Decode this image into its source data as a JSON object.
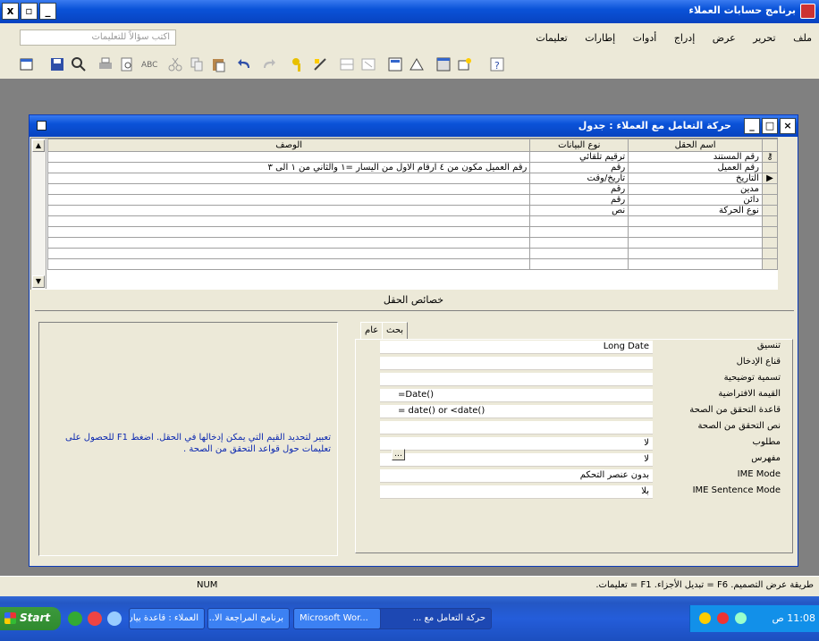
{
  "app": {
    "title": "برنامج حسابات العملاء",
    "min_label": "_",
    "max_label": "▫",
    "close_label": "x"
  },
  "menu": {
    "items": [
      "ملف",
      "تحرير",
      "عرض",
      "إدراج",
      "أدوات",
      "إطارات",
      "تعليمات"
    ],
    "ask_placeholder": "اكتب سؤالاً للتعليمات"
  },
  "child": {
    "title": "حركة التعامل مع العملاء : جدول"
  },
  "grid": {
    "headers": {
      "name": "اسم الحقل",
      "type": "نوع البيانات",
      "desc": "الوصف"
    },
    "rows": [
      {
        "name": "رقم المستند",
        "type": "ترقيم تلقائي",
        "desc": ""
      },
      {
        "name": "رقم العميل",
        "type": "رقم",
        "desc": "رقم العميل مكون من ٤ ارقام الاول من اليسار =١ والثاني من ١ الى ٣"
      },
      {
        "name": "التاريخ",
        "type": "تاريخ/وقت",
        "desc": ""
      },
      {
        "name": "مدين",
        "type": "رقم",
        "desc": ""
      },
      {
        "name": "دائن",
        "type": "رقم",
        "desc": ""
      },
      {
        "name": "نوع الحركة",
        "type": "نص",
        "desc": ""
      },
      {
        "name": "",
        "type": "",
        "desc": ""
      },
      {
        "name": "",
        "type": "",
        "desc": ""
      },
      {
        "name": "",
        "type": "",
        "desc": ""
      },
      {
        "name": "",
        "type": "",
        "desc": ""
      },
      {
        "name": "",
        "type": "",
        "desc": ""
      }
    ]
  },
  "properties": {
    "caption": "خصائص الحقل",
    "tabs": [
      "عام",
      "بحث"
    ],
    "rows": [
      {
        "label": "تنسيق",
        "value": "Long Date"
      },
      {
        "label": "قناع الإدخال",
        "value": ""
      },
      {
        "label": "تسمية توضيحية",
        "value": ""
      },
      {
        "label": "القيمة الافتراضية",
        "value": "=Date()"
      },
      {
        "label": "قاعدة التحقق من الصحة",
        "value": "= date() or <date()"
      },
      {
        "label": "نص التحقق من الصحة",
        "value": ""
      },
      {
        "label": "مطلوب",
        "value": "لا"
      },
      {
        "label": "مفهرس",
        "value": "لا"
      },
      {
        "label": "IME Mode",
        "value": "بدون عنصر التحكم"
      },
      {
        "label": "IME Sentence Mode",
        "value": "بلا"
      }
    ],
    "help_text": "تعبير لتحديد القيم التي يمكن إدخالها في الحقل. اضغط F1 للحصول على تعليمات حول قواعد التحقق من الصحة ."
  },
  "status": {
    "text": "طريقة عرض التصميم. F6 = تبديل الأجزاء. F1 = تعليمات.",
    "num": "NUM"
  },
  "taskbar": {
    "start": "Start",
    "buttons": [
      "حركة التعامل مع ...",
      "Microsoft Wor...",
      "برنامج المراجعة الا...",
      "العملاء : قاعدة بيان..."
    ],
    "clock": "11:08 ص"
  },
  "colors": {
    "titlebar": "#0a52d8",
    "taskbar": "#245dda",
    "help_text": "#0b28b0",
    "mdi_background": "#808080"
  }
}
